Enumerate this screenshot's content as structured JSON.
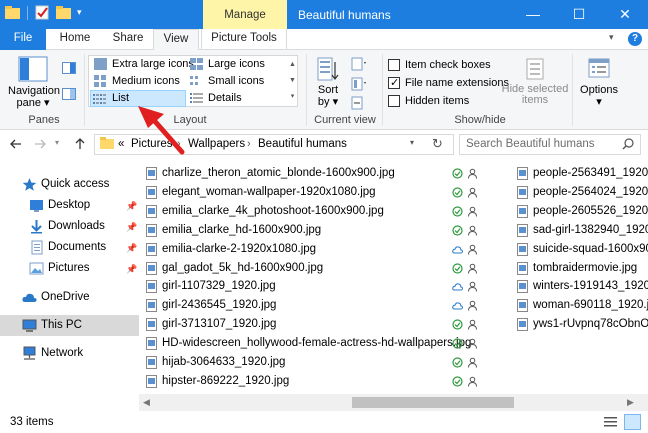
{
  "window": {
    "title": "Beautiful humans",
    "context_tab": "Manage",
    "minimize": "—",
    "maximize": "☐",
    "close": "✕"
  },
  "tabs": {
    "file": "File",
    "home": "Home",
    "share": "Share",
    "view": "View",
    "picture_tools": "Picture Tools"
  },
  "ribbon": {
    "panes": {
      "navigation_pane": "Navigation pane ▾",
      "group_label": "Panes"
    },
    "layout": {
      "extra_large_icons": "Extra large icons",
      "large_icons": "Large icons",
      "medium_icons": "Medium icons",
      "small_icons": "Small icons",
      "list": "List",
      "details": "Details",
      "group_label": "Layout"
    },
    "current_view": {
      "sort_by": "Sort by ▾",
      "group_label": "Current view"
    },
    "show_hide": {
      "item_check_boxes": "Item check boxes",
      "file_name_extensions": "File name extensions",
      "hidden_items": "Hidden items",
      "hide_selected_items": "Hide selected items",
      "group_label": "Show/hide"
    },
    "options": "Options ▾"
  },
  "address": {
    "crumbs": [
      "«",
      "Pictures",
      "Wallpapers",
      "Beautiful humans"
    ],
    "search_placeholder": "Search Beautiful humans"
  },
  "navigation": {
    "quick_access": "Quick access",
    "desktop": "Desktop",
    "downloads": "Downloads",
    "documents": "Documents",
    "pictures": "Pictures",
    "onedrive": "OneDrive",
    "this_pc": "This PC",
    "network": "Network"
  },
  "files": {
    "column1": [
      {
        "name": "charlize_theron_atomic_blonde-1600x900.jpg",
        "status": "synced"
      },
      {
        "name": "elegant_woman-wallpaper-1920x1080.jpg",
        "status": "synced"
      },
      {
        "name": "emilia_clarke_4k_photoshoot-1600x900.jpg",
        "status": "synced"
      },
      {
        "name": "emilia_clarke_hd-1600x900.jpg",
        "status": "synced"
      },
      {
        "name": "emilia-clarke-2-1920x1080.jpg",
        "status": "cloud"
      },
      {
        "name": "gal_gadot_5k_hd-1600x900.jpg",
        "status": "synced"
      },
      {
        "name": "girl-1107329_1920.jpg",
        "status": "cloud"
      },
      {
        "name": "girl-2436545_1920.jpg",
        "status": "cloud"
      },
      {
        "name": "girl-3713107_1920.jpg",
        "status": "synced"
      },
      {
        "name": "HD-widescreen_hollywood-female-actress-hd-wallpapers.jpg",
        "status": "synced"
      },
      {
        "name": "hijab-3064633_1920.jpg",
        "status": "synced"
      },
      {
        "name": "hipster-869222_1920.jpg",
        "status": "synced"
      }
    ],
    "column2": [
      {
        "name": "people-2563491_1920.jpg"
      },
      {
        "name": "people-2564024_1920.jpg"
      },
      {
        "name": "people-2605526_1920.jpg"
      },
      {
        "name": "sad-girl-1382940_1920.jpg"
      },
      {
        "name": "suicide-squad-1600x900-"
      },
      {
        "name": "tombraidermovie.jpg"
      },
      {
        "name": "winters-1919143_1920.jpg"
      },
      {
        "name": "woman-690118_1920.jpg"
      },
      {
        "name": "yws1-rUvpnq78cObnO3U"
      }
    ]
  },
  "statusbar": {
    "item_count": "33 items"
  },
  "colors": {
    "accent": "#1e7ee0",
    "manage_tab": "#fff5a8",
    "selection": "#cce8ff",
    "synced_green": "#2e9a3e",
    "cloud_blue": "#2a78c8",
    "annotation_red": "#e02020"
  }
}
